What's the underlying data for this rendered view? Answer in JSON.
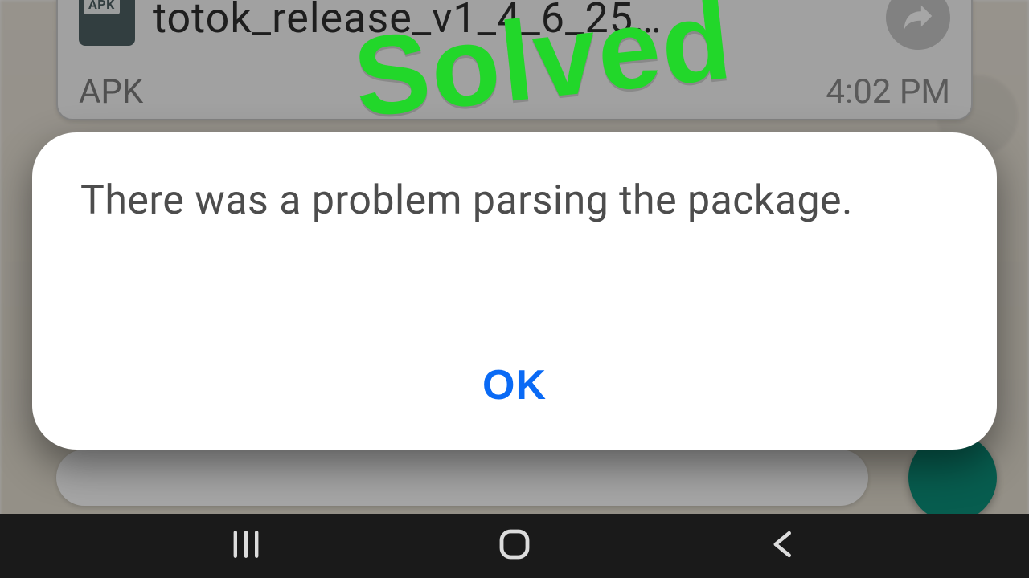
{
  "overlay": {
    "solved_text": "Solved",
    "solved_color": "#22d72a"
  },
  "attachment": {
    "badge_label": "APK",
    "file_name_truncated": "totok_release_v1_4_6_25…",
    "type_label": "APK",
    "timestamp": "4:02 PM",
    "forward_icon": "forward-arrow-icon"
  },
  "dialog": {
    "message": "There was a problem parsing the package.",
    "ok_label": "OK"
  },
  "navbar": {
    "recent_icon": "recent-apps-icon",
    "home_icon": "home-icon",
    "back_icon": "back-icon"
  },
  "colors": {
    "dialog_bg": "#ffffff",
    "dialog_text": "#4d4d4d",
    "dialog_button": "#0a6af5",
    "fab": "#0b8f7a",
    "navbar": "#1a1a1a",
    "apk_badge": "#4e6063"
  }
}
